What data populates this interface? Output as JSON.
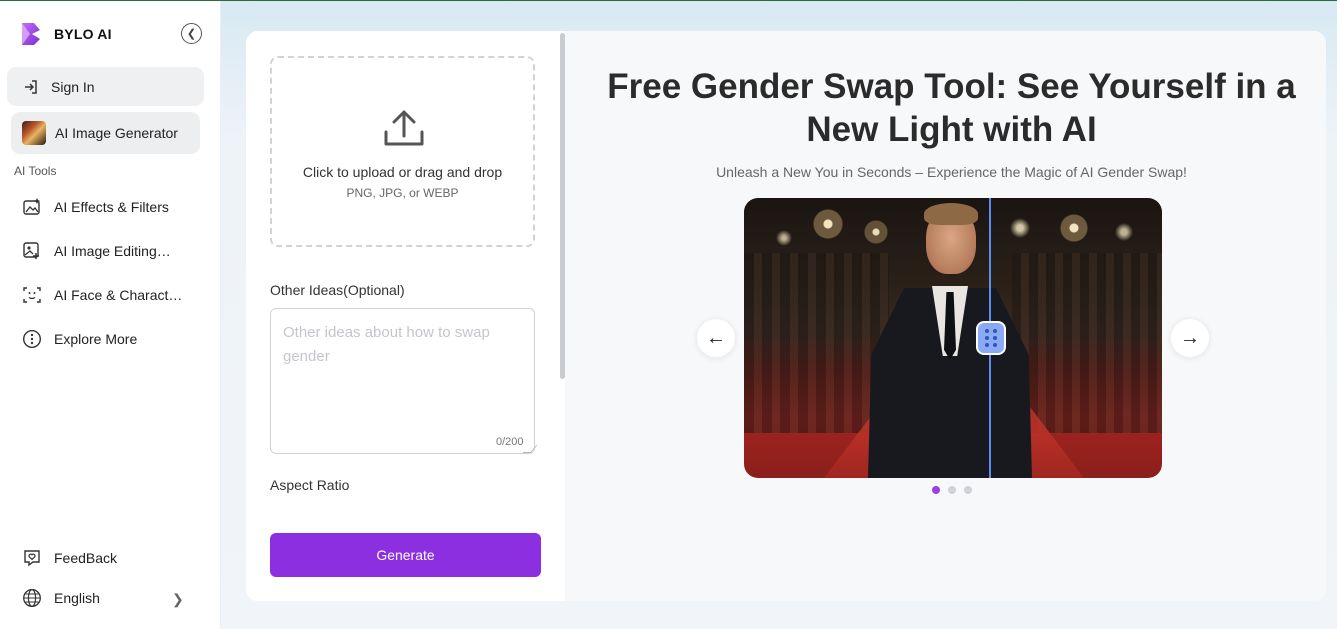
{
  "brand": {
    "name": "BYLO AI",
    "accent": "#8b2fe0"
  },
  "sidebar": {
    "sign_in": "Sign In",
    "current_tool": "AI Image Generator",
    "section_label": "AI Tools",
    "items": [
      {
        "label": "AI Effects & Filters",
        "icon": "image-sparkle-icon"
      },
      {
        "label": "AI Image Editing…",
        "icon": "image-edit-icon"
      },
      {
        "label": "AI Face & Charact…",
        "icon": "face-scan-icon"
      },
      {
        "label": "Explore More",
        "icon": "more-circle-icon"
      }
    ],
    "feedback": "FeedBack",
    "language": "English"
  },
  "form": {
    "upload_title": "Click to upload or drag and drop",
    "upload_formats": "PNG, JPG, or WEBP",
    "ideas_label": "Other Ideas(Optional)",
    "ideas_placeholder": "Other ideas about how to swap gender",
    "ideas_counter": "0/200",
    "aspect_label": "Aspect Ratio",
    "generate_label": "Generate"
  },
  "preview": {
    "title": "Free Gender Swap Tool: See Yourself in a New Light with AI",
    "subtitle": "Unleash a New You in Seconds – Experience the Magic of AI Gender Swap!",
    "prev_label": "←",
    "next_label": "→",
    "slide_count": 3,
    "active_slide": 1
  }
}
